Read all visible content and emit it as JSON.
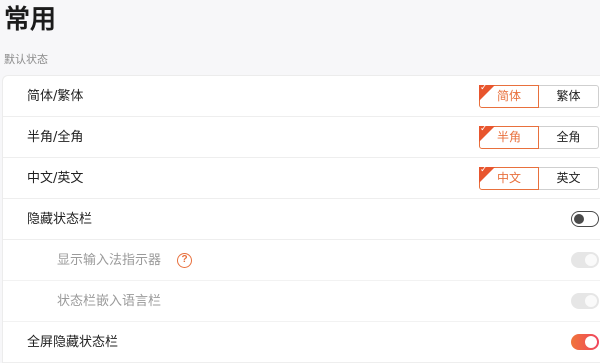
{
  "page": {
    "title": "常用",
    "section_label": "默认状态"
  },
  "colors": {
    "accent": "#e8703d",
    "toggle_on_start": "#f0753a",
    "toggle_on_end": "#f0445e"
  },
  "rows": [
    {
      "label": "简体/繁体",
      "options": [
        "简体",
        "繁体"
      ],
      "selected": "简体"
    },
    {
      "label": "半角/全角",
      "options": [
        "半角",
        "全角"
      ],
      "selected": "半角"
    },
    {
      "label": "中文/英文",
      "options": [
        "中文",
        "英文"
      ],
      "selected": "中文"
    }
  ],
  "toggles": [
    {
      "label": "隐藏状态栏",
      "state": "off",
      "enabled": true
    },
    {
      "label": "显示输入法指示器",
      "state": "on",
      "enabled": false,
      "help_icon": "question-circle-icon",
      "help_glyph": "?"
    },
    {
      "label": "状态栏嵌入语言栏",
      "state": "on",
      "enabled": false
    },
    {
      "label": "全屏隐藏状态栏",
      "state": "on",
      "enabled": true
    }
  ]
}
